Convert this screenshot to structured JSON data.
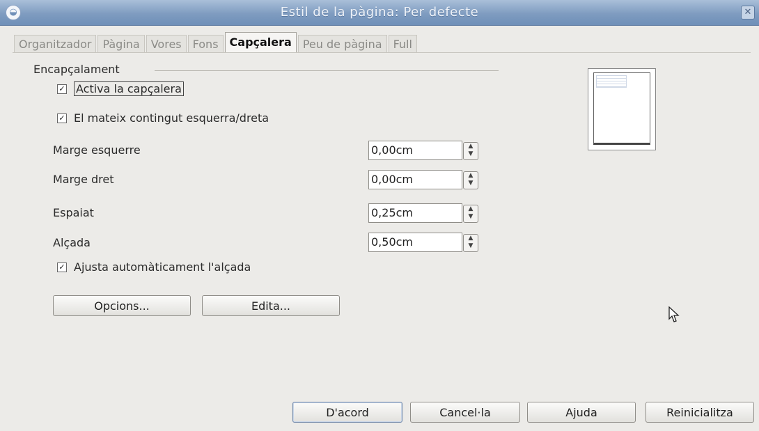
{
  "window": {
    "title": "Estil de la pàgina: Per defecte",
    "close_icon": "close-icon",
    "app_icon": "app-icon"
  },
  "tabs": [
    {
      "label": "Organitzador",
      "active": false
    },
    {
      "label": "Pàgina",
      "active": false
    },
    {
      "label": "Vores",
      "active": false
    },
    {
      "label": "Fons",
      "active": false
    },
    {
      "label": "Capçalera",
      "active": true
    },
    {
      "label": "Peu de pàgina",
      "active": false
    },
    {
      "label": "Full",
      "active": false
    }
  ],
  "header_section": {
    "title": "Encapçalament",
    "activate": {
      "label": "Activa la capçalera",
      "checked": true
    },
    "same_content": {
      "label": "El mateix contingut esquerra/dreta",
      "checked": true
    },
    "left_margin": {
      "label": "Marge esquerre",
      "value": "0,00cm"
    },
    "right_margin": {
      "label": "Marge dret",
      "value": "0,00cm"
    },
    "spacing": {
      "label": "Espaiat",
      "value": "0,25cm"
    },
    "height": {
      "label": "Alçada",
      "value": "0,50cm"
    },
    "autofit": {
      "label": "Ajusta automàticament l'alçada",
      "checked": true
    },
    "options_button": "Opcions...",
    "edit_button": "Edita..."
  },
  "footer_buttons": {
    "ok": "D'acord",
    "cancel": "Cancel·la",
    "help": "Ajuda",
    "reset": "Reinicialitza"
  },
  "colors": {
    "titlebar": "#7f9cc0",
    "background": "#ecebe8"
  }
}
